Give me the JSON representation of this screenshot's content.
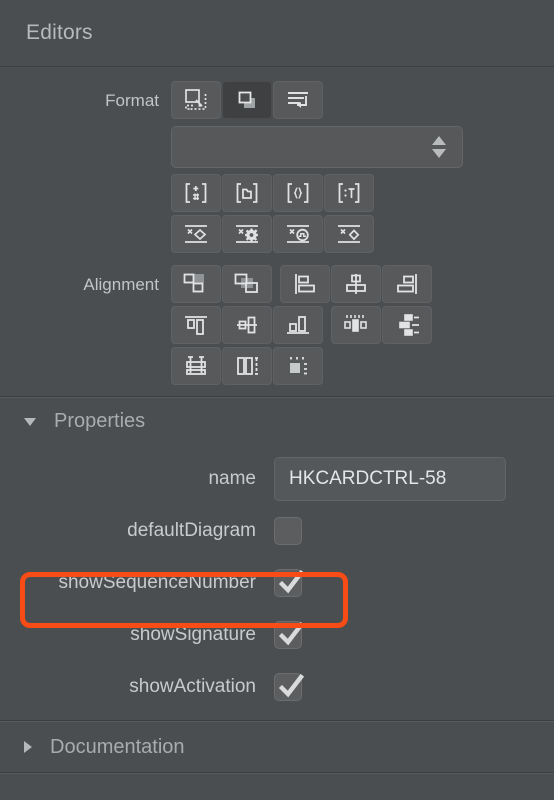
{
  "header": {
    "title": "Editors"
  },
  "format": {
    "label": "Format",
    "row1": [
      {
        "name": "select-all-icon",
        "active": false
      },
      {
        "name": "bring-to-front-icon",
        "active": true
      },
      {
        "name": "align-text-icon",
        "active": false
      }
    ],
    "combo": {
      "value": "",
      "placeholder": ""
    },
    "row2": [
      {
        "name": "insert-feature-icon"
      },
      {
        "name": "insert-package-icon"
      },
      {
        "name": "insert-braces-icon"
      },
      {
        "name": "insert-tag-icon"
      }
    ],
    "row3": [
      {
        "name": "delete-shape-icon"
      },
      {
        "name": "delete-settings-icon"
      },
      {
        "name": "delete-signal-icon"
      },
      {
        "name": "delete-element-icon"
      }
    ]
  },
  "alignment": {
    "label": "Alignment",
    "buttons": [
      {
        "name": "bring-forward-icon",
        "gap": false
      },
      {
        "name": "send-backward-icon",
        "gap": false
      },
      {
        "name": "align-left-icon",
        "gap": true
      },
      {
        "name": "align-center-icon",
        "gap": false
      },
      {
        "name": "align-right-icon",
        "gap": false
      },
      {
        "name": "align-top-icon",
        "gap": false
      },
      {
        "name": "align-middle-icon",
        "gap": false
      },
      {
        "name": "align-bottom-icon",
        "gap": false
      },
      {
        "name": "distribute-horizontal-icon",
        "gap": true
      },
      {
        "name": "distribute-vertical-icon",
        "gap": false
      },
      {
        "name": "same-height-icon",
        "gap": false
      },
      {
        "name": "same-width-icon",
        "gap": false
      },
      {
        "name": "same-size-icon",
        "gap": false
      }
    ]
  },
  "properties": {
    "title": "Properties",
    "expanded": true,
    "name_row": {
      "label": "name",
      "value": "HKCARDCTRL-58"
    },
    "checkboxes": [
      {
        "label": "defaultDiagram",
        "checked": false,
        "highlighted": false
      },
      {
        "label": "showSequenceNumber",
        "checked": true,
        "highlighted": true
      },
      {
        "label": "showSignature",
        "checked": true,
        "highlighted": false
      },
      {
        "label": "showActivation",
        "checked": true,
        "highlighted": false
      }
    ]
  },
  "documentation": {
    "title": "Documentation",
    "expanded": false
  },
  "colors": {
    "background": "#4b4e50",
    "button": "#57595b",
    "button_active": "#3e4042",
    "text": "#c9cbcc",
    "annotation": "#f74c16",
    "icon": "#d5d7d8"
  }
}
